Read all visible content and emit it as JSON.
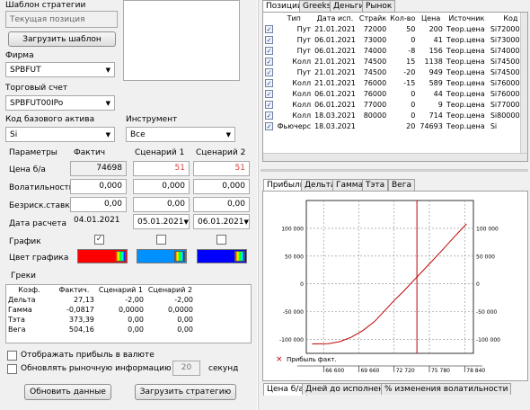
{
  "left": {
    "template_label": "Шаблон стратегии",
    "template_placeholder": "Текущая позиция",
    "load_template_button": "Загрузить шаблон",
    "firm_label": "Фирма",
    "firm_value": "SPBFUT",
    "account_label": "Торговый счет",
    "account_value": "SPBFUT00IPo",
    "base_asset_label": "Код базового актива",
    "base_asset_value": "Si",
    "instrument_label": "Инструмент",
    "instrument_value": "Все"
  },
  "params": {
    "headers": [
      "Параметры",
      "Фактич",
      "Сценарий 1",
      "Сценарий 2"
    ],
    "price_label": "Цена б/а",
    "price_fact": "74698",
    "price_s1": "51",
    "price_s2": "51",
    "vol_label": "Волатильность",
    "vol_fact": "0,000",
    "vol_s1": "0,000",
    "vol_s2": "0,000",
    "rate_label": "Безриск.ставка",
    "rate_fact": "0,00",
    "rate_s1": "0,00",
    "rate_s2": "0,00",
    "date_label": "Дата расчета",
    "date_fact": "04.01.2021",
    "date_s1": "05.01.2021",
    "date_s2": "06.01.2021",
    "chart_label": "График",
    "color_label": "Цвет графика",
    "colors": [
      "#ff0000",
      "#0090ff",
      "#0000ff"
    ]
  },
  "greeks": {
    "title": "Греки",
    "headers": [
      "Коэф.",
      "Фактич.",
      "Сценарий 1",
      "Сценарий 2"
    ],
    "rows": [
      [
        "Дельта",
        "27,13",
        "-2,00",
        "-2,00"
      ],
      [
        "Гамма",
        "-0,0817",
        "0,0000",
        "0,0000"
      ],
      [
        "Тэта",
        "373,39",
        "0,00",
        "0,00"
      ],
      [
        "Вега",
        "504,16",
        "0,00",
        "0,00"
      ]
    ]
  },
  "options": {
    "show_profit_currency": "Отображать прибыль в валюте",
    "refresh_label": "Обновлять рыночную информацию раз в",
    "refresh_value": "20",
    "refresh_unit": "секунд"
  },
  "buttons": {
    "refresh_data": "Обновить данные",
    "load_strategy": "Загрузить стратегию"
  },
  "top_tabs": [
    "Позиции",
    "Greeks",
    "Деньги",
    "Рынок"
  ],
  "positions": {
    "headers": [
      "Тип",
      "Дата исп.",
      "Страйк",
      "Кол-во",
      "Цена",
      "Источник",
      "Код"
    ],
    "rows": [
      [
        "Пут",
        "21.01.2021",
        "72000",
        "50",
        "200",
        "Теор.цена",
        "Si72000BM"
      ],
      [
        "Пут",
        "06.01.2021",
        "73000",
        "0",
        "41",
        "Теор.цена",
        "Si73000BM"
      ],
      [
        "Пут",
        "06.01.2021",
        "74000",
        "-8",
        "156",
        "Теор.цена",
        "Si74000BM"
      ],
      [
        "Колл",
        "21.01.2021",
        "74500",
        "15",
        "1138",
        "Теор.цена",
        "Si74500BA"
      ],
      [
        "Пут",
        "21.01.2021",
        "74500",
        "-20",
        "949",
        "Теор.цена",
        "Si74500BM"
      ],
      [
        "Колл",
        "21.01.2021",
        "76000",
        "-15",
        "589",
        "Теор.цена",
        "Si76000BA"
      ],
      [
        "Колл",
        "06.01.2021",
        "76000",
        "0",
        "44",
        "Теор.цена",
        "Si76000BA"
      ],
      [
        "Колл",
        "06.01.2021",
        "77000",
        "0",
        "9",
        "Теор.цена",
        "Si77000BA"
      ],
      [
        "Колл",
        "18.03.2021",
        "80000",
        "0",
        "714",
        "Теор.цена",
        "Si80000B"
      ],
      [
        "Фьючерс",
        "18.03.2021",
        "",
        "20",
        "74693",
        "Теор.цена",
        "Si"
      ]
    ]
  },
  "chart_tabs": [
    "Прибыль",
    "Дельта",
    "Гамма",
    "Тэта",
    "Вега"
  ],
  "bottom_tabs": [
    "Цена б/а",
    "Дней до исполнения",
    "% изменения волатильности"
  ],
  "chart_data": {
    "type": "line",
    "series": [
      {
        "name": "Прибыль факт.",
        "color": "#c00000",
        "x": [
          65600,
          67000,
          68000,
          69000,
          70000,
          71000,
          72000,
          72720,
          73500,
          74500,
          75780,
          77000,
          78000,
          79000
        ],
        "y": [
          -108000,
          -107500,
          -104000,
          -96000,
          -84000,
          -68000,
          -46000,
          -30000,
          -14000,
          8000,
          36000,
          63000,
          86000,
          108000
        ]
      }
    ],
    "x_ticks": [
      "66 600",
      "69 660",
      "72 720",
      "75 780",
      "78 840"
    ],
    "x_tick_values": [
      66600,
      69660,
      72720,
      75780,
      78840
    ],
    "y_ticks": [
      "100 000",
      "50 000",
      "0",
      "-50 000",
      "-100 000"
    ],
    "y_tick_values": [
      100000,
      50000,
      0,
      -50000,
      -100000
    ],
    "xlim": [
      65100,
      79600
    ],
    "ylim": [
      -125000,
      150000
    ],
    "vline": 74698,
    "grid": true,
    "legend_marker": "×"
  }
}
